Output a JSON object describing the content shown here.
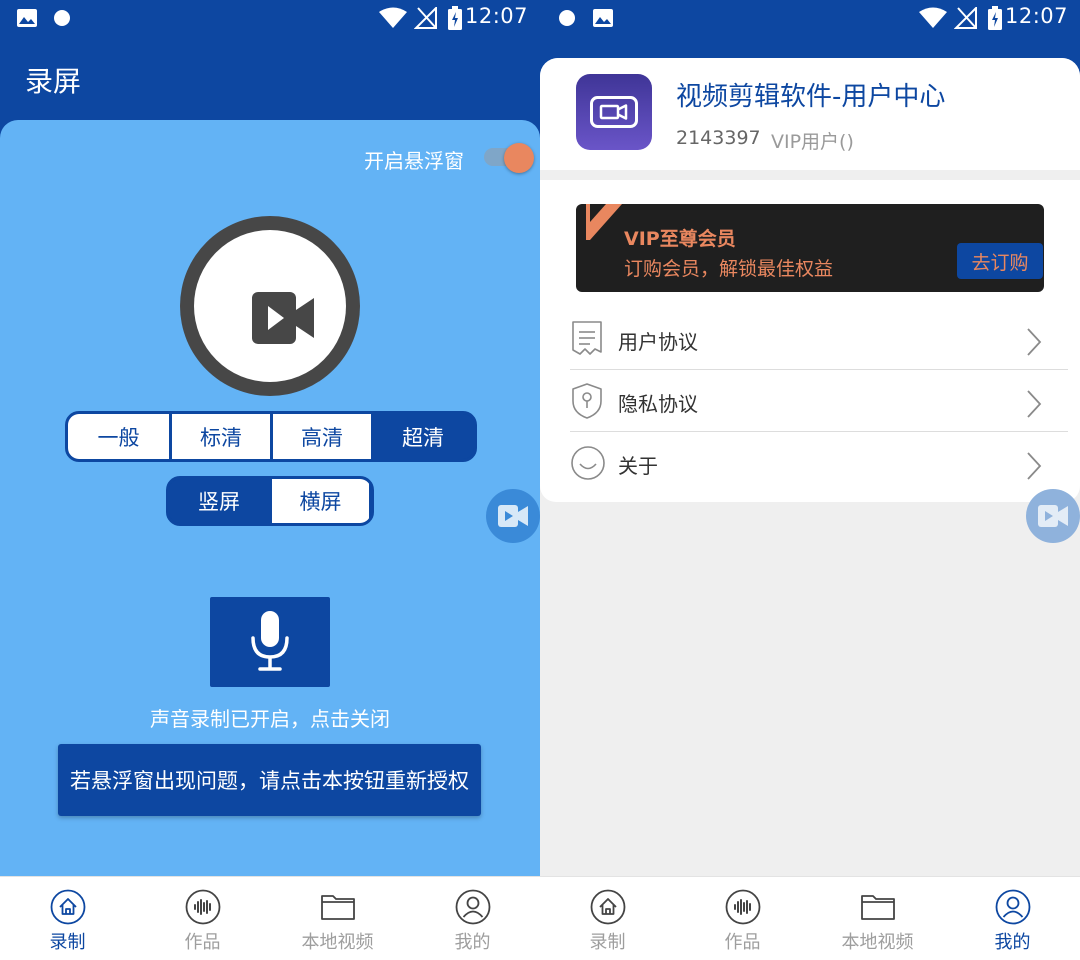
{
  "status_bar": {
    "time": "12:07"
  },
  "left": {
    "title": "录屏",
    "float_window_label": "开启悬浮窗",
    "float_window_enabled": true,
    "quality_options": [
      "一般",
      "标清",
      "高清",
      "超清"
    ],
    "quality_selected": "超清",
    "orientation_options": [
      "竖屏",
      "横屏"
    ],
    "orientation_selected": "竖屏",
    "audio_status": "声音录制已开启，点击关闭",
    "reauth_button": "若悬浮窗出现问题，请点击本按钮重新授权"
  },
  "right": {
    "app_name": "视频剪辑软件-用户中心",
    "user_id": "2143397",
    "user_vip": "VIP用户()",
    "vip_banner": {
      "title": "VIP至尊会员",
      "subtitle": "订购会员，解锁最佳权益",
      "button": "去订购"
    },
    "menu": [
      {
        "label": "用户协议",
        "icon": "document-icon"
      },
      {
        "label": "隐私协议",
        "icon": "shield-lock-icon"
      },
      {
        "label": "关于",
        "icon": "smile-icon"
      }
    ]
  },
  "tabs": [
    {
      "label": "录制",
      "icon": "home-icon"
    },
    {
      "label": "作品",
      "icon": "audio-wave-icon"
    },
    {
      "label": "本地视频",
      "icon": "folder-icon"
    },
    {
      "label": "我的",
      "icon": "user-icon"
    }
  ],
  "colors": {
    "primary": "#0d47a1",
    "panel_blue": "#63b3f5",
    "accent_orange": "#e9875f",
    "inactive_gray": "#9e9e9e"
  }
}
